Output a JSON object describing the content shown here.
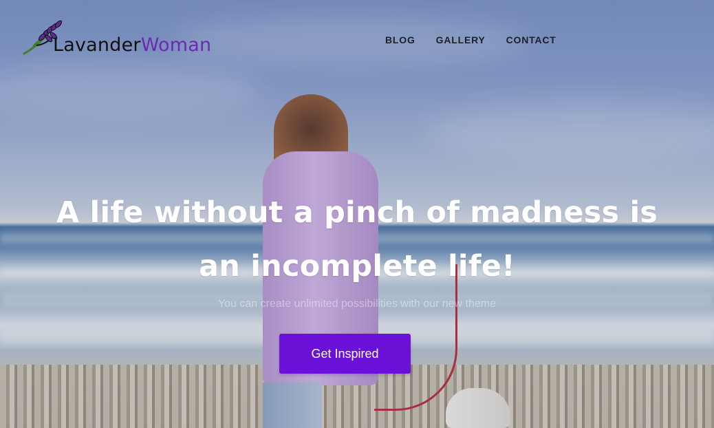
{
  "brand": {
    "name_part_1": "Lavander",
    "name_part_2": "Woman",
    "icon": "lavender-sprig-icon",
    "accent_color": "#6a2bb1"
  },
  "nav": {
    "items": [
      {
        "label": "BLOG"
      },
      {
        "label": "GALLERY"
      },
      {
        "label": "CONTACT"
      }
    ]
  },
  "hero": {
    "headline": "A life without a pinch of madness is an incomplete life!",
    "subtitle": "You can create unlimited possibilities with our new theme",
    "cta_label": "Get Inspired",
    "cta_color": "#6b10d6"
  }
}
